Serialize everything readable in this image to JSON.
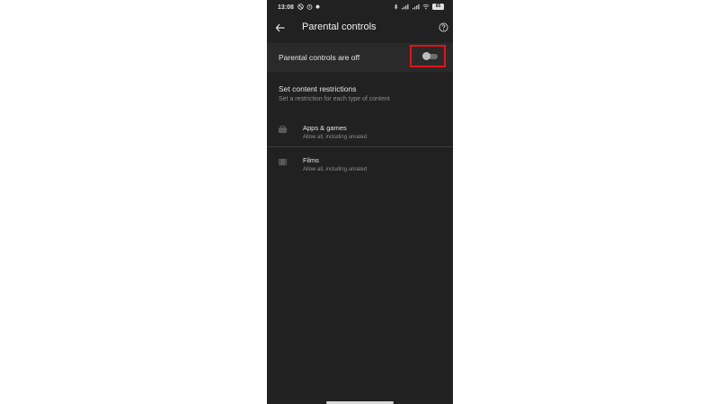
{
  "status_bar": {
    "time": "13:08",
    "battery": "85"
  },
  "app_bar": {
    "title": "Parental controls",
    "back_icon": "arrow-left-icon",
    "help_icon": "help-circle-icon"
  },
  "master_toggle": {
    "label": "Parental controls are off",
    "enabled": false
  },
  "restrictions": {
    "title": "Set content restrictions",
    "subtitle": "Set a restriction for each type of content",
    "items": [
      {
        "title": "Apps & games",
        "subtitle": "Allow all, including unrated",
        "icon": "apps-games-icon"
      },
      {
        "title": "Films",
        "subtitle": "Allow all, including unrated",
        "icon": "film-icon"
      }
    ]
  },
  "colors": {
    "background": "#212121",
    "highlight": "#e0141b",
    "toggle_off_track": "#6e6e6e",
    "toggle_off_thumb": "#bdbdbd"
  }
}
